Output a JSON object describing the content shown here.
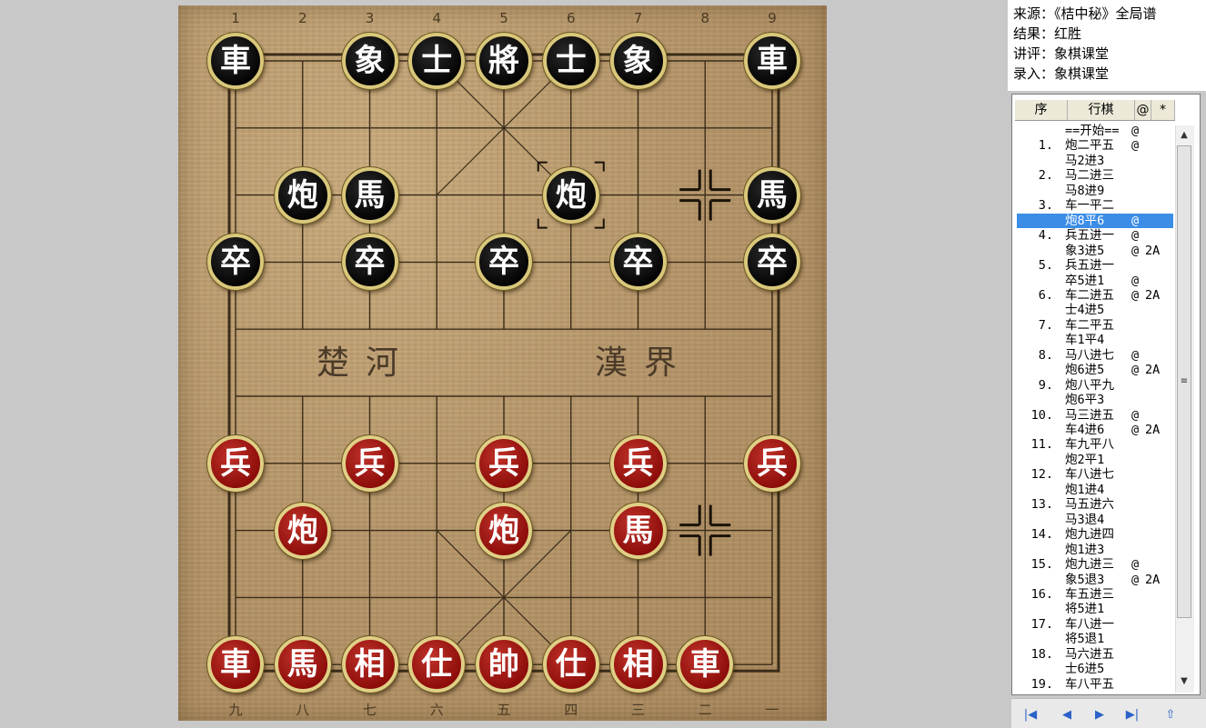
{
  "board": {
    "file_labels_top": [
      "1",
      "2",
      "3",
      "4",
      "5",
      "6",
      "7",
      "8",
      "9"
    ],
    "file_labels_bottom": [
      "九",
      "八",
      "七",
      "六",
      "五",
      "四",
      "三",
      "二",
      "一"
    ],
    "river_left": "楚河",
    "river_right": "漢界",
    "pieces": [
      {
        "name": "black-chariot-left",
        "side": "black",
        "char": "車",
        "col": 0,
        "row": 0
      },
      {
        "name": "black-elephant-left",
        "side": "black",
        "char": "象",
        "col": 2,
        "row": 0
      },
      {
        "name": "black-advisor-left",
        "side": "black",
        "char": "士",
        "col": 3,
        "row": 0
      },
      {
        "name": "black-general",
        "side": "black",
        "char": "將",
        "col": 4,
        "row": 0
      },
      {
        "name": "black-advisor-right",
        "side": "black",
        "char": "士",
        "col": 5,
        "row": 0
      },
      {
        "name": "black-elephant-right",
        "side": "black",
        "char": "象",
        "col": 6,
        "row": 0
      },
      {
        "name": "black-chariot-right",
        "side": "black",
        "char": "車",
        "col": 8,
        "row": 0
      },
      {
        "name": "black-cannon-left",
        "side": "black",
        "char": "炮",
        "col": 1,
        "row": 2
      },
      {
        "name": "black-horse-left",
        "side": "black",
        "char": "馬",
        "col": 2,
        "row": 2
      },
      {
        "name": "black-cannon-right",
        "side": "black",
        "char": "炮",
        "col": 5,
        "row": 2
      },
      {
        "name": "black-horse-right",
        "side": "black",
        "char": "馬",
        "col": 8,
        "row": 2
      },
      {
        "name": "black-soldier-1",
        "side": "black",
        "char": "卒",
        "col": 0,
        "row": 3
      },
      {
        "name": "black-soldier-3",
        "side": "black",
        "char": "卒",
        "col": 2,
        "row": 3
      },
      {
        "name": "black-soldier-5",
        "side": "black",
        "char": "卒",
        "col": 4,
        "row": 3
      },
      {
        "name": "black-soldier-7",
        "side": "black",
        "char": "卒",
        "col": 6,
        "row": 3
      },
      {
        "name": "black-soldier-9",
        "side": "black",
        "char": "卒",
        "col": 8,
        "row": 3
      },
      {
        "name": "red-soldier-1",
        "side": "red",
        "char": "兵",
        "col": 0,
        "row": 6
      },
      {
        "name": "red-soldier-3",
        "side": "red",
        "char": "兵",
        "col": 2,
        "row": 6
      },
      {
        "name": "red-soldier-5",
        "side": "red",
        "char": "兵",
        "col": 4,
        "row": 6
      },
      {
        "name": "red-soldier-7",
        "side": "red",
        "char": "兵",
        "col": 6,
        "row": 6
      },
      {
        "name": "red-soldier-9",
        "side": "red",
        "char": "兵",
        "col": 8,
        "row": 6
      },
      {
        "name": "red-cannon-left",
        "side": "red",
        "char": "炮",
        "col": 1,
        "row": 7
      },
      {
        "name": "red-cannon-center",
        "side": "red",
        "char": "炮",
        "col": 4,
        "row": 7
      },
      {
        "name": "red-horse-right",
        "side": "red",
        "char": "馬",
        "col": 6,
        "row": 7
      },
      {
        "name": "red-chariot-left",
        "side": "red",
        "char": "車",
        "col": 0,
        "row": 9
      },
      {
        "name": "red-horse-left",
        "side": "red",
        "char": "馬",
        "col": 1,
        "row": 9
      },
      {
        "name": "red-elephant-left",
        "side": "red",
        "char": "相",
        "col": 2,
        "row": 9
      },
      {
        "name": "red-advisor-left",
        "side": "red",
        "char": "仕",
        "col": 3,
        "row": 9
      },
      {
        "name": "red-general",
        "side": "red",
        "char": "帥",
        "col": 4,
        "row": 9
      },
      {
        "name": "red-advisor-right",
        "side": "red",
        "char": "仕",
        "col": 5,
        "row": 9
      },
      {
        "name": "red-elephant-right",
        "side": "red",
        "char": "相",
        "col": 6,
        "row": 9
      },
      {
        "name": "red-chariot-right",
        "side": "red",
        "char": "車",
        "col": 7,
        "row": 9
      }
    ],
    "last_move_from": {
      "col": 7,
      "row": 2
    },
    "last_move_to": {
      "col": 5,
      "row": 2
    },
    "hint_marker": {
      "col": 7,
      "row": 7
    }
  },
  "info": {
    "source": "来源：《桔中秘》全局谱",
    "result": "结果：红胜",
    "commentary": "讲评：象棋课堂",
    "entry": "录入：象棋课堂"
  },
  "move_list": {
    "headers": [
      "序",
      "行棋",
      "@",
      "*"
    ],
    "selected_index": 6,
    "rows": [
      {
        "num": "",
        "move": "==开始==",
        "at": "@",
        "cmt": ""
      },
      {
        "num": "1.",
        "move": "炮二平五",
        "at": "@",
        "cmt": ""
      },
      {
        "num": "",
        "move": "马2进3",
        "at": "",
        "cmt": ""
      },
      {
        "num": "2.",
        "move": "马二进三",
        "at": "",
        "cmt": ""
      },
      {
        "num": "",
        "move": "马8进9",
        "at": "",
        "cmt": ""
      },
      {
        "num": "3.",
        "move": "车一平二",
        "at": "",
        "cmt": ""
      },
      {
        "num": "",
        "move": "炮8平6",
        "at": "@",
        "cmt": ""
      },
      {
        "num": "4.",
        "move": "兵五进一",
        "at": "@",
        "cmt": ""
      },
      {
        "num": "",
        "move": "象3进5",
        "at": "@",
        "cmt": "2A"
      },
      {
        "num": "5.",
        "move": "兵五进一",
        "at": "",
        "cmt": ""
      },
      {
        "num": "",
        "move": "卒5进1",
        "at": "@",
        "cmt": ""
      },
      {
        "num": "6.",
        "move": "车二进五",
        "at": "@",
        "cmt": "2A"
      },
      {
        "num": "",
        "move": "士4进5",
        "at": "",
        "cmt": ""
      },
      {
        "num": "7.",
        "move": "车二平五",
        "at": "",
        "cmt": ""
      },
      {
        "num": "",
        "move": "车1平4",
        "at": "",
        "cmt": ""
      },
      {
        "num": "8.",
        "move": "马八进七",
        "at": "@",
        "cmt": ""
      },
      {
        "num": "",
        "move": "炮6进5",
        "at": "@",
        "cmt": "2A"
      },
      {
        "num": "9.",
        "move": "炮八平九",
        "at": "",
        "cmt": ""
      },
      {
        "num": "",
        "move": "炮6平3",
        "at": "",
        "cmt": ""
      },
      {
        "num": "10.",
        "move": "马三进五",
        "at": "@",
        "cmt": ""
      },
      {
        "num": "",
        "move": "车4进6",
        "at": "@",
        "cmt": "2A"
      },
      {
        "num": "11.",
        "move": "车九平八",
        "at": "",
        "cmt": ""
      },
      {
        "num": "",
        "move": "炮2平1",
        "at": "",
        "cmt": ""
      },
      {
        "num": "12.",
        "move": "车八进七",
        "at": "",
        "cmt": ""
      },
      {
        "num": "",
        "move": "炮1进4",
        "at": "",
        "cmt": ""
      },
      {
        "num": "13.",
        "move": "马五进六",
        "at": "",
        "cmt": ""
      },
      {
        "num": "",
        "move": "马3退4",
        "at": "",
        "cmt": ""
      },
      {
        "num": "14.",
        "move": "炮九进四",
        "at": "",
        "cmt": ""
      },
      {
        "num": "",
        "move": "炮1进3",
        "at": "",
        "cmt": ""
      },
      {
        "num": "15.",
        "move": "炮九进三",
        "at": "@",
        "cmt": ""
      },
      {
        "num": "",
        "move": "象5退3",
        "at": "@",
        "cmt": "2A"
      },
      {
        "num": "16.",
        "move": "车五进三",
        "at": "",
        "cmt": ""
      },
      {
        "num": "",
        "move": "将5进1",
        "at": "",
        "cmt": ""
      },
      {
        "num": "17.",
        "move": "车八进一",
        "at": "",
        "cmt": ""
      },
      {
        "num": "",
        "move": "将5退1",
        "at": "",
        "cmt": ""
      },
      {
        "num": "18.",
        "move": "马六进五",
        "at": "",
        "cmt": ""
      },
      {
        "num": "",
        "move": "士6进5",
        "at": "",
        "cmt": ""
      },
      {
        "num": "19.",
        "move": "车八平五",
        "at": "",
        "cmt": ""
      }
    ]
  },
  "icons": {
    "scroll_up": "▲",
    "scroll_down": "▼",
    "scroll_grip": "≡",
    "nav": [
      "|◀",
      "◀",
      "▶",
      "▶|",
      "⇧"
    ]
  }
}
